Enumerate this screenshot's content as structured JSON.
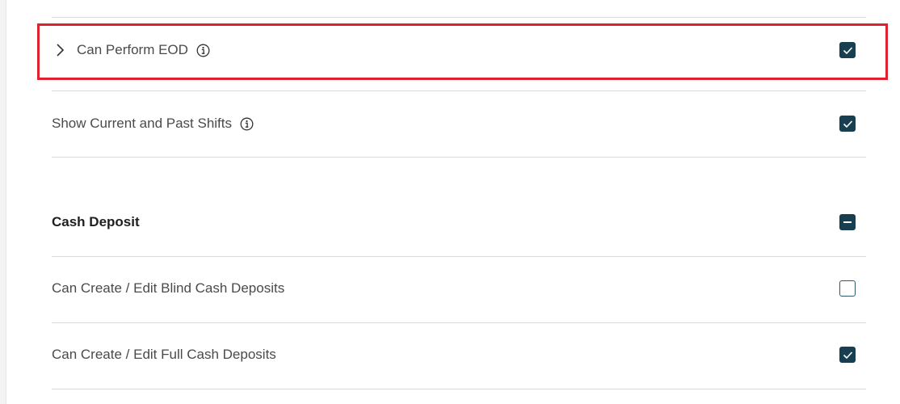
{
  "permissions": {
    "eod": {
      "label": "Can Perform EOD",
      "has_info": true,
      "expandable": true,
      "checked": true
    },
    "shifts": {
      "label": "Show Current and Past Shifts",
      "has_info": true,
      "checked": true
    },
    "cash_deposit": {
      "title": "Cash Deposit",
      "state": "indeterminate",
      "items": [
        {
          "label": "Can Create / Edit Blind Cash Deposits",
          "checked": false
        },
        {
          "label": "Can Create / Edit Full Cash Deposits",
          "checked": true
        }
      ]
    }
  },
  "icons": {
    "expand": "chevron-right-icon",
    "info": "info-icon",
    "check": "checkmark-icon",
    "indeterminate": "minus-icon"
  },
  "colors": {
    "checkbox_fill": "#173f4f",
    "highlight": "#e0212e",
    "text": "#4a4a4a",
    "divider": "#d9d9d9"
  }
}
